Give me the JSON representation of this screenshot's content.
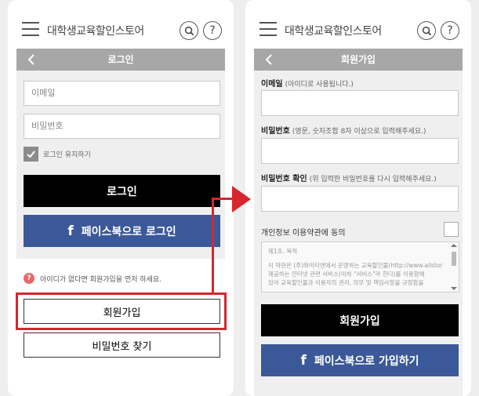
{
  "brand_name": "대학생교육할인스토어",
  "header_icons": {
    "search": "search-icon",
    "help_glyph": "?"
  },
  "colors": {
    "facebook": "#3b5998",
    "highlight": "#d7262e",
    "titlebar": "#a7a7a7",
    "notice_icon": "#e8686a"
  },
  "login": {
    "title": "로그인",
    "email_placeholder": "이메일",
    "password_placeholder": "비밀번호",
    "keep_logged_in": "로그인 유지하기",
    "login_button": "로그인",
    "facebook_login": "페이스북으로 로그인",
    "notice_icon_glyph": "?",
    "notice": "아이디가 없다면 회원가입을 먼저 하세요.",
    "signup_button": "회원가입",
    "find_password_button": "비밀번호 찾기"
  },
  "signup": {
    "title": "회원가입",
    "email_label": "이메일",
    "email_hint": "(아이디로 사용됩니다.)",
    "password_label": "비밀번호",
    "password_hint": "(영문, 숫자조합 8자 이상으로 입력해주세요.)",
    "confirm_label": "비밀번호 확인",
    "confirm_hint": "(위 입력한 비밀번호를 다시 입력해주세요.)",
    "agree_label": "개인정보 이용약관에 동의",
    "terms_heading": "제1조. 목적",
    "terms_lines": [
      "이 약관은 (주)와이티엔에서 운영하는 교육할인몰(http://www.allstor",
      "제공하는 인터넷 관련 서비스(이하 \"서비스\"라 한다)를 이용함에",
      "있어 교육할인몰과 이용자의 권리, 의무 및 책임사항을 규정함을"
    ],
    "signup_button": "회원가입",
    "facebook_signup": "페이스북으로 가입하기"
  },
  "facebook_glyph": "f"
}
